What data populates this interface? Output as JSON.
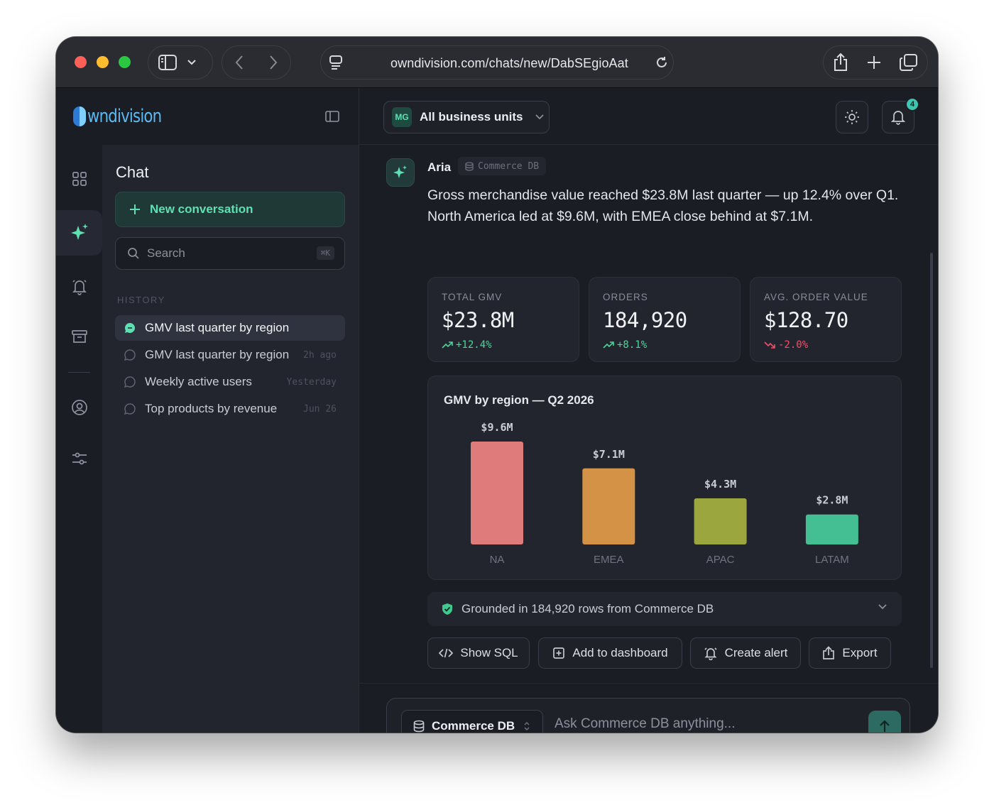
{
  "browser": {
    "url": "owndivision.com/chats/new/DabSEgioAat"
  },
  "brand": {
    "name": "wndivision"
  },
  "rail": {
    "icons": [
      "grid-icon",
      "sparkle-icon",
      "bell-icon",
      "archive-icon",
      "user-circle-icon",
      "sliders-icon"
    ]
  },
  "sidebar": {
    "title": "Chat",
    "new_conversation": "New conversation",
    "search_placeholder": "Search",
    "search_shortcut": "⌘K",
    "history_label": "HISTORY",
    "history": [
      {
        "label": "GMV last quarter by region",
        "time": "",
        "active": true
      },
      {
        "label": "GMV last quarter by region",
        "time": "2h ago",
        "active": false
      },
      {
        "label": "Weekly active users",
        "time": "Yesterday",
        "active": false
      },
      {
        "label": "Top products by revenue",
        "time": "Jun 26",
        "active": false
      }
    ]
  },
  "topbar": {
    "unit_badge": "MG",
    "unit_label": "All business units",
    "notification_count": "4"
  },
  "message": {
    "sender": "Aria",
    "source": "Commerce DB",
    "text": "Gross merchandise value reached $23.8M last quarter — up 12.4% over Q1. North America led at $9.6M, with EMEA close behind at $7.1M."
  },
  "kpis": [
    {
      "label": "TOTAL GMV",
      "value": "$23.8M",
      "delta": "+12.4%",
      "direction": "up"
    },
    {
      "label": "ORDERS",
      "value": "184,920",
      "delta": "+8.1%",
      "direction": "up"
    },
    {
      "label": "AVG. ORDER VALUE",
      "value": "$128.70",
      "delta": "-2.0%",
      "direction": "down"
    }
  ],
  "chart_data": {
    "type": "bar",
    "title": "GMV by region — Q2 2026",
    "categories": [
      "NA",
      "EMEA",
      "APAC",
      "LATAM"
    ],
    "values": [
      9.6,
      7.1,
      4.3,
      2.8
    ],
    "value_labels": [
      "$9.6M",
      "$7.1M",
      "$4.3M",
      "$2.8M"
    ],
    "colors": [
      "#e07b7b",
      "#d39246",
      "#9ba63f",
      "#44bf93"
    ],
    "xlabel": "",
    "ylabel": "",
    "grid": false
  },
  "grounding": {
    "text": "Grounded in 184,920 rows from Commerce DB"
  },
  "actions": {
    "show_sql": "Show SQL",
    "add_dashboard": "Add to dashboard",
    "create_alert": "Create alert",
    "export": "Export"
  },
  "composer": {
    "db_label": "Commerce DB",
    "placeholder": "Ask Commerce DB anything..."
  },
  "colors": {
    "accent": "#5ee0b3",
    "positive": "#4cd69a",
    "negative": "#f0506b"
  }
}
